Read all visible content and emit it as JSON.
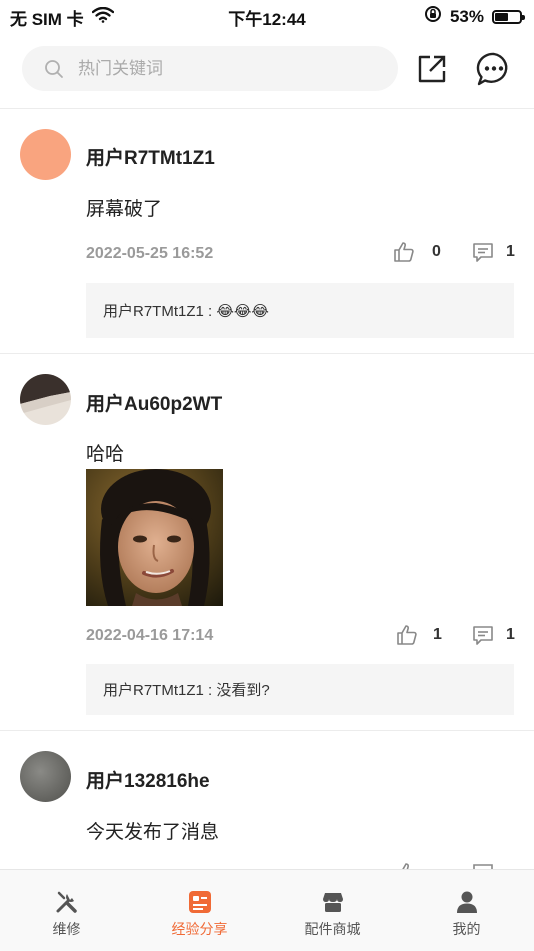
{
  "status_bar": {
    "carrier": "无 SIM 卡",
    "time": "下午12:44",
    "battery": "53%",
    "battery_level": 0.53
  },
  "search": {
    "placeholder": "热门关键词"
  },
  "posts": [
    {
      "user": "用户R7TMt1Z1",
      "text": "屏幕破了",
      "date": "2022-05-25 16:52",
      "likes": "0",
      "comments": "1",
      "reply": "用户R7TMt1Z1 : 😂😂😂",
      "avatar_color": "#f9a47f"
    },
    {
      "user": "用户Au60p2WT",
      "text": "哈哈",
      "date": "2022-04-16 17:14",
      "likes": "1",
      "comments": "1",
      "reply": "用户R7TMt1Z1 : 没看到?"
    },
    {
      "user": "用户132816he",
      "text": "今天发布了消息",
      "avatar_color": "#6e6e6a"
    }
  ],
  "tabs": [
    {
      "label": "维修",
      "icon": "wrench-screwdriver-icon",
      "active": false
    },
    {
      "label": "经验分享",
      "icon": "experience-share-icon",
      "active": true
    },
    {
      "label": "配件商城",
      "icon": "store-icon",
      "active": false
    },
    {
      "label": "我的",
      "icon": "person-icon",
      "active": false
    }
  ],
  "colors": {
    "accent": "#f06a36",
    "divider": "#ececec",
    "reply_bg": "#f5f5f5"
  }
}
